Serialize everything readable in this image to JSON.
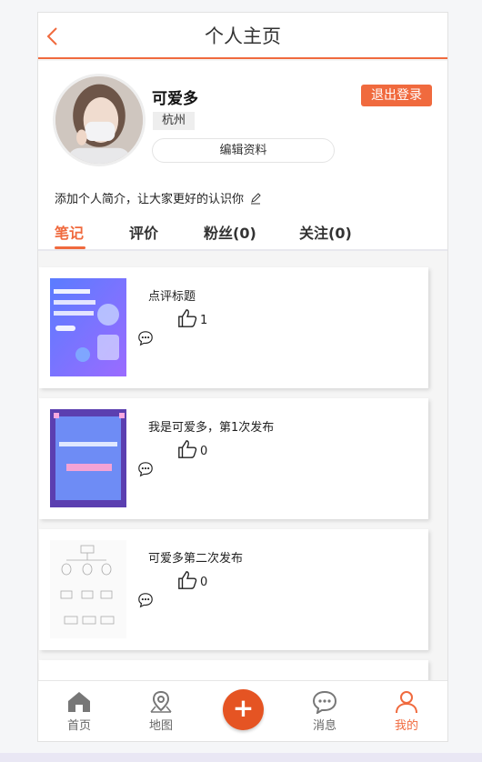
{
  "header": {
    "title": "个人主页"
  },
  "profile": {
    "username": "可爱多",
    "city": "杭州",
    "logout_label": "退出登录",
    "edit_label": "编辑资料",
    "bio": "添加个人简介，让大家更好的认识你"
  },
  "tabs": [
    {
      "label": "笔记",
      "active": true
    },
    {
      "label": "评价"
    },
    {
      "label": "粉丝(0)"
    },
    {
      "label": "关注(0)"
    }
  ],
  "posts": [
    {
      "title": "点评标题",
      "likes": "1",
      "thumb": "thumb-docker-redis-icon"
    },
    {
      "title": "我是可爱多，第1次发布",
      "likes": "0",
      "thumb": "thumb-purple-board-icon"
    },
    {
      "title": "可爱多第二次发布",
      "likes": "0",
      "thumb": "thumb-flowchart-icon"
    }
  ],
  "nav": [
    {
      "label": "首页",
      "icon": "home-icon"
    },
    {
      "label": "地图",
      "icon": "map-pin-icon"
    },
    {
      "label": "+",
      "icon": "add-icon"
    },
    {
      "label": "消息",
      "icon": "message-icon"
    },
    {
      "label": "我的",
      "icon": "user-icon",
      "active": true
    }
  ],
  "colors": {
    "accent": "#f06a3e",
    "fab": "#e55423"
  }
}
